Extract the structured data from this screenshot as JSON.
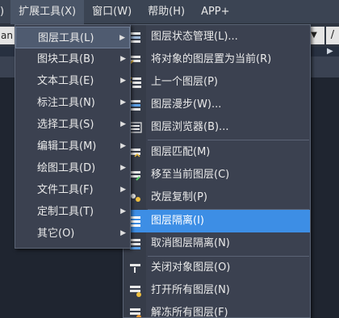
{
  "menubar": {
    "items": [
      ")",
      "扩展工具(X)",
      "窗口(W)",
      "帮助(H)",
      "APP+"
    ]
  },
  "toolbar": {
    "left_field": "an",
    "combo_arrow": "▼",
    "right_button": "/"
  },
  "extension_menu": {
    "items": [
      {
        "label": "图层工具(L)",
        "has_submenu": true,
        "selected": true
      },
      {
        "label": "图块工具(B)",
        "has_submenu": true
      },
      {
        "label": "文本工具(E)",
        "has_submenu": true
      },
      {
        "label": "标注工具(N)",
        "has_submenu": true
      },
      {
        "label": "选择工具(S)",
        "has_submenu": true
      },
      {
        "label": "编辑工具(M)",
        "has_submenu": true
      },
      {
        "label": "绘图工具(D)",
        "has_submenu": true
      },
      {
        "label": "文件工具(F)",
        "has_submenu": true
      },
      {
        "label": "定制工具(T)",
        "has_submenu": true
      },
      {
        "label": "其它(O)",
        "has_submenu": true
      }
    ]
  },
  "layer_tools_menu": {
    "items": [
      {
        "label": "图层状态管理(L)...",
        "icon": "layer-state-icon"
      },
      {
        "label": "将对象的图层置为当前(R)",
        "icon": "make-object-layer-current-icon"
      },
      {
        "label": "上一个图层(P)",
        "icon": "layer-previous-icon"
      },
      {
        "label": "图层漫步(W)...",
        "icon": "layer-walk-icon"
      },
      {
        "label": "图层浏览器(B)...",
        "icon": "layer-browser-icon"
      },
      {
        "label": "图层匹配(M)",
        "icon": "layer-match-icon"
      },
      {
        "label": "移至当前图层(C)",
        "icon": "move-to-current-layer-icon"
      },
      {
        "label": "改层复制(P)",
        "icon": "copy-to-layer-icon"
      },
      {
        "label": "图层隔离(I)",
        "icon": "layer-isolate-icon",
        "selected": true
      },
      {
        "label": "取消图层隔离(N)",
        "icon": "layer-unisolate-icon"
      },
      {
        "label": "关闭对象图层(O)",
        "icon": "layer-off-icon"
      },
      {
        "label": "打开所有图层(N)",
        "icon": "all-layers-on-icon"
      },
      {
        "label": "解冻所有图层(F)",
        "icon": "thaw-all-layers-icon"
      }
    ]
  },
  "colors": {
    "selection": "#3d8ee5",
    "menu_bg": "#3b4150",
    "menubar_bg": "#3b4453"
  }
}
